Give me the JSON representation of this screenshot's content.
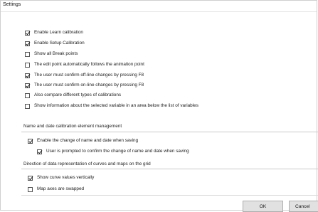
{
  "window": {
    "title": "Settings"
  },
  "general": {
    "options": [
      {
        "label": "Enable Learn calibration",
        "checked": true
      },
      {
        "label": "Enable Setup Calibration",
        "checked": true
      },
      {
        "label": "Show all Break points",
        "checked": false
      },
      {
        "label": "The edit point automatically follows the animation point",
        "checked": false
      },
      {
        "label": "The user must confirm off-line changes by pressing F8",
        "checked": true
      },
      {
        "label": "The user must confirm on-line changes by pressing F8",
        "checked": true
      },
      {
        "label": "Also compare different types of calibrations",
        "checked": false
      },
      {
        "label": "Show information about the selected variable in an area below the list of variables",
        "checked": false
      }
    ]
  },
  "name_date_group": {
    "title": "Name and date calibration element management",
    "options": [
      {
        "label": "Enable the change of name and date when saving",
        "checked": true
      },
      {
        "label": "User is prompted to confirm the change of name and date when saving",
        "checked": true
      }
    ]
  },
  "direction_group": {
    "title": "Direction of data representation of curves and maps on the grid",
    "options": [
      {
        "label": "Show curve values vertically",
        "checked": true
      },
      {
        "label": "Map axes are swapped",
        "checked": false
      }
    ]
  },
  "buttons": {
    "ok": "OK",
    "cancel": "Cancel"
  }
}
